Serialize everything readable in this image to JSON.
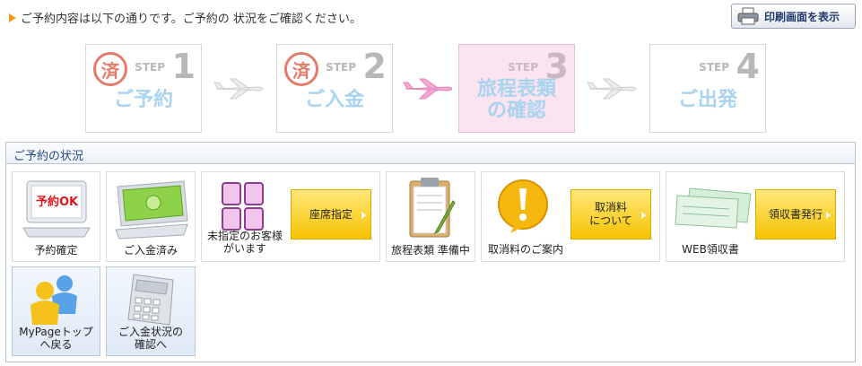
{
  "notice": {
    "text": "ご予約内容は以下の通りです。ご予約の 状況をご確認ください。"
  },
  "print_button": {
    "label": "印刷画面を表示"
  },
  "steps": [
    {
      "step_label": "STEP",
      "num": "1",
      "title": "ご予約",
      "done_mark": "済"
    },
    {
      "step_label": "STEP",
      "num": "2",
      "title": "ご入金",
      "done_mark": "済"
    },
    {
      "step_label": "STEP",
      "num": "3",
      "title_line1": "旅程表類",
      "title_line2": "の確認"
    },
    {
      "step_label": "STEP",
      "num": "4",
      "title": "ご出発"
    }
  ],
  "status_panel": {
    "title": "ご予約の状況",
    "cards": {
      "reservation": {
        "badge": "予約OK",
        "label": "予約確定"
      },
      "payment": {
        "label": "ご入金済み"
      },
      "seats": {
        "label_line1": "未指定のお客様",
        "label_line2": "がいます",
        "button": "座席指定"
      },
      "itinerary": {
        "label": "旅程表類 準備中"
      },
      "cancel": {
        "label": "取消料のご案内",
        "button_line1": "取消料",
        "button_line2": "について"
      },
      "receipt": {
        "label": "WEB領収書",
        "button": "領収書発行"
      },
      "mypage": {
        "label_line1": "MyPageトップ",
        "label_line2": "へ戻る"
      },
      "payment_status": {
        "label_line1": "ご入金状況の",
        "label_line2": "確認へ"
      }
    }
  },
  "colors": {
    "accent_orange": "#f29a1b",
    "step_text": "#a9d4ef",
    "active_step_bg": "#fbe3f0",
    "button_yellow": "#f5c200",
    "panel_title": "#244a86"
  }
}
